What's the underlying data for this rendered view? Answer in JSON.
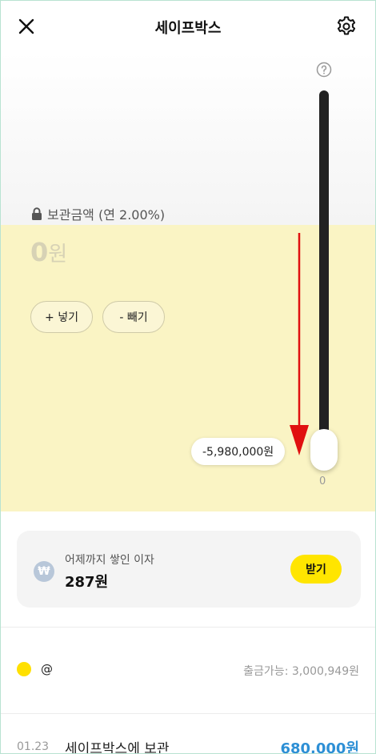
{
  "header": {
    "title": "세이프박스",
    "close_icon": "close-icon",
    "settings_icon": "gear-icon"
  },
  "safebox": {
    "label": "보관금액 (연 2.00%)",
    "amount": "0",
    "unit": "원",
    "deposit_label": "+ 넣기",
    "withdraw_label": "- 빼기"
  },
  "slider": {
    "tooltip": "-5,980,000원",
    "min_label": "0",
    "help_icon": "question-icon"
  },
  "interest": {
    "label": "어제까지 쌓인 이자",
    "value": "287원",
    "icon_glyph": "₩",
    "receive_label": "받기"
  },
  "account": {
    "name": "@",
    "withdrawable": "출금가능: 3,000,949원"
  },
  "history": [
    {
      "date": "01.23",
      "description": "세이프박스에 보관",
      "amount": "680,000원"
    }
  ],
  "colors": {
    "accent_yellow": "#ffe500",
    "panel_yellow": "#faf4c4",
    "amount_blue": "#2d8fd5",
    "annotation_red": "#e01010"
  }
}
